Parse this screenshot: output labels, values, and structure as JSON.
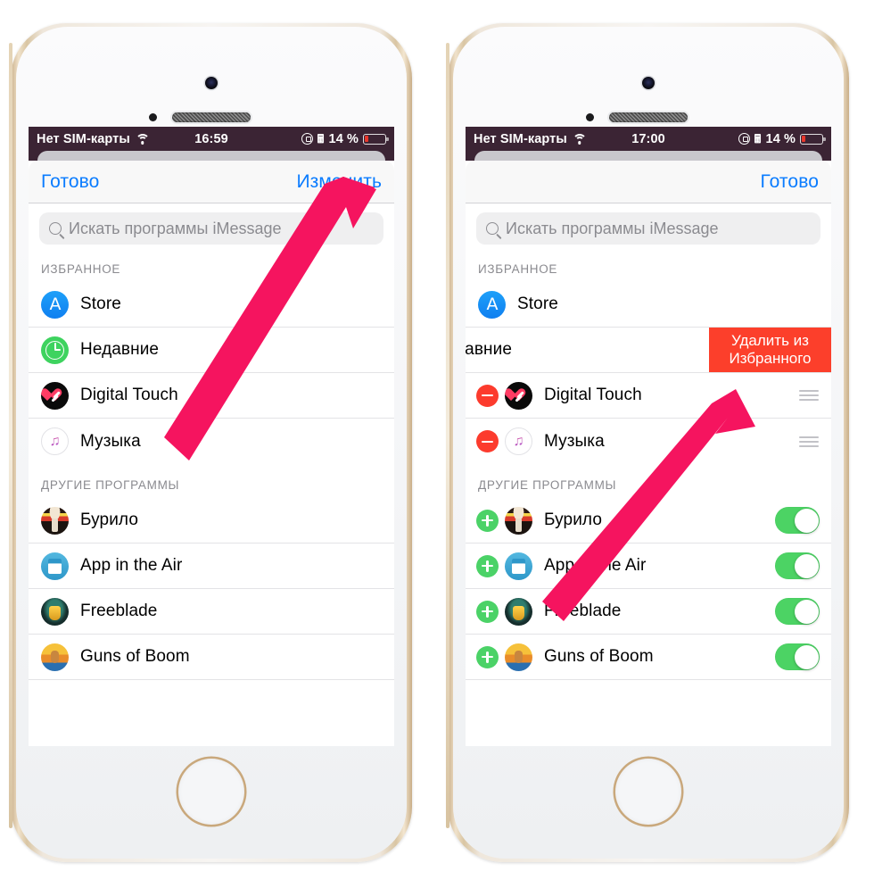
{
  "statusbar": {
    "carrier": "Нет SIM-карты",
    "wifi_icon": "wifi-icon",
    "time_left": "16:59",
    "time_right": "17:00",
    "rotation_lock_icon": "rotation-lock-icon",
    "bluetooth_icon": "bluetooth-icon",
    "battery_percent": "14 %",
    "battery_level": 14,
    "battery_color": "#e8372c",
    "background": "#3b2434"
  },
  "colors": {
    "accent_blue": "#0a7cff",
    "destructive_red": "#fc3f2b",
    "toggle_green": "#4cd364",
    "add_green": "#4bd267",
    "arrow_pink": "#f5145f"
  },
  "left_phone": {
    "navbar": {
      "left_label": "Готово",
      "right_label": "Изменить"
    },
    "search": {
      "placeholder": "Искать программы iMessage",
      "icon": "search-icon"
    },
    "sections": [
      {
        "header": "ИЗБРАННОЕ",
        "rows": [
          {
            "label": "Store",
            "icon": "app-store-icon"
          },
          {
            "label": "Недавние",
            "icon": "recents-clock-icon"
          },
          {
            "label": "Digital Touch",
            "icon": "digital-touch-icon"
          },
          {
            "label": "Музыка",
            "icon": "apple-music-icon"
          }
        ]
      },
      {
        "header": "ДРУГИЕ ПРОГРАММЫ",
        "rows": [
          {
            "label": "Бурило",
            "icon": "burilo-app-icon"
          },
          {
            "label": "App in the Air",
            "icon": "app-in-the-air-icon"
          },
          {
            "label": "Freeblade",
            "icon": "freeblade-app-icon"
          },
          {
            "label": "Guns of Boom",
            "icon": "guns-of-boom-icon"
          }
        ]
      }
    ]
  },
  "right_phone": {
    "navbar": {
      "left_label": "",
      "right_label": "Готово"
    },
    "search": {
      "placeholder": "Искать программы iMessage",
      "icon": "search-icon"
    },
    "swipe_action_label": "Удалить из Избранного",
    "sections": [
      {
        "header": "ИЗБРАННОЕ",
        "rows": [
          {
            "label": "Store",
            "icon": "app-store-icon",
            "control": "none"
          },
          {
            "label": "давние",
            "icon": "recents-clock-icon",
            "control": "grip",
            "swiped": true
          },
          {
            "label": "Digital Touch",
            "icon": "digital-touch-icon",
            "control": "minus-grip"
          },
          {
            "label": "Музыка",
            "icon": "apple-music-icon",
            "control": "minus-grip"
          }
        ]
      },
      {
        "header": "ДРУГИЕ ПРОГРАММЫ",
        "rows": [
          {
            "label": "Бурило",
            "icon": "burilo-app-icon",
            "control": "plus-toggle",
            "toggle_on": true
          },
          {
            "label": "App in the Air",
            "icon": "app-in-the-air-icon",
            "control": "plus-toggle",
            "toggle_on": true
          },
          {
            "label": "Freeblade",
            "icon": "freeblade-app-icon",
            "control": "plus-toggle",
            "toggle_on": true
          },
          {
            "label": "Guns of Boom",
            "icon": "guns-of-boom-icon",
            "control": "plus-toggle",
            "toggle_on": true
          }
        ]
      }
    ]
  },
  "annotations": [
    {
      "name": "arrow-to-edit-button",
      "target": "Изменить"
    },
    {
      "name": "arrow-to-delete-action",
      "target": "Удалить из Избранного"
    }
  ]
}
